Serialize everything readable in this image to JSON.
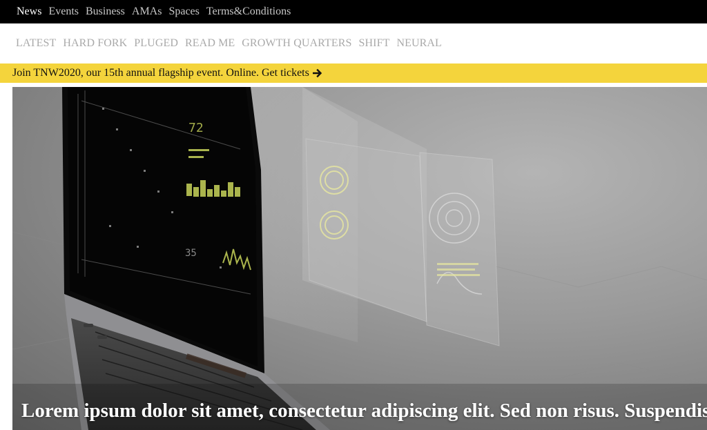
{
  "top_nav": {
    "items": [
      {
        "label": "News",
        "active": true
      },
      {
        "label": "Events",
        "active": false
      },
      {
        "label": "Business",
        "active": false
      },
      {
        "label": "AMAs",
        "active": false
      },
      {
        "label": "Spaces",
        "active": false
      },
      {
        "label": "Terms&Conditions",
        "active": false
      }
    ]
  },
  "sub_nav": {
    "items": [
      "LATEST",
      "HARD FORK",
      "PLUGED",
      "READ ME",
      "GROWTH QUARTERS",
      "SHIFT",
      "NEURAL"
    ]
  },
  "banner": {
    "text": "Join TNW2020, our 15th annual flagship event. Online. Get tickets",
    "icon": "arrow-right-icon",
    "background": "#f4d43c"
  },
  "hero": {
    "image": "laptop-holographic-screens-image",
    "title": "Lorem ipsum dolor sit amet, consectetur adipiscing elit. Sed non risus. Suspendisse lectus tortor, dignissim sit amet"
  },
  "colors": {
    "top_bar": "#000000",
    "active_link": "#ffffff",
    "inactive_link": "#c8c8c8",
    "sub_nav_text": "#a9a9a9"
  }
}
